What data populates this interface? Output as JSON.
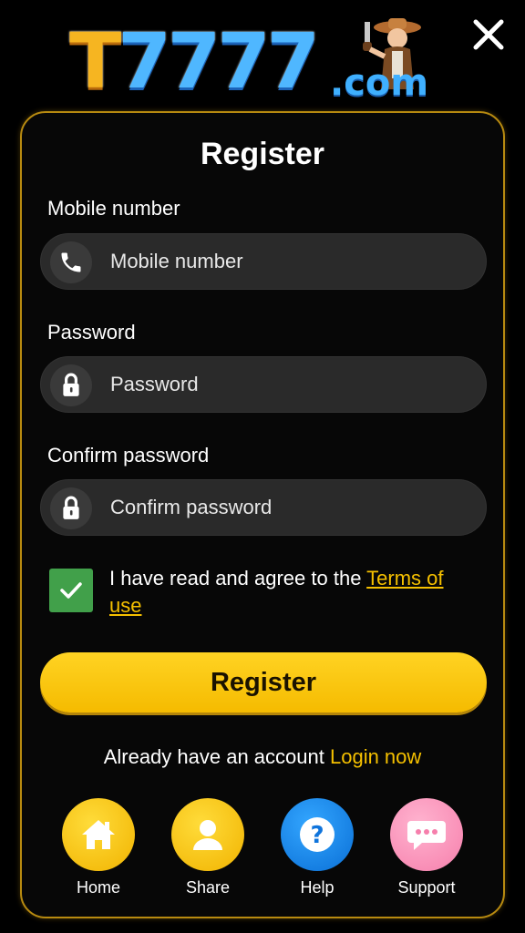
{
  "header": {
    "logo": {
      "prefix": "T",
      "digits": "7777",
      "suffix": ".com"
    },
    "close_icon": "close-icon"
  },
  "form": {
    "title": "Register",
    "mobile": {
      "label": "Mobile number",
      "placeholder": "Mobile number",
      "value": "",
      "icon": "phone-icon"
    },
    "password": {
      "label": "Password",
      "placeholder": "Password",
      "value": "",
      "icon": "lock-icon"
    },
    "confirm": {
      "label": "Confirm password",
      "placeholder": "Confirm password",
      "value": "",
      "icon": "lock-icon"
    },
    "agree": {
      "checked": true,
      "text": "I have read and agree to the ",
      "link": "Terms of use"
    },
    "submit_label": "Register",
    "login_prompt": "Already have an account ",
    "login_link": "Login now"
  },
  "bottom_nav": [
    {
      "label": "Home",
      "icon": "home-icon",
      "color": "#f5c000"
    },
    {
      "label": "Share",
      "icon": "user-icon",
      "color": "#f5c000"
    },
    {
      "label": "Help",
      "icon": "help-icon",
      "color": "#1c86f0"
    },
    {
      "label": "Support",
      "icon": "chat-icon",
      "color": "#f88db6"
    }
  ],
  "colors": {
    "accent": "#f5c000",
    "card_border": "#b78a10",
    "check": "#41a04a"
  }
}
